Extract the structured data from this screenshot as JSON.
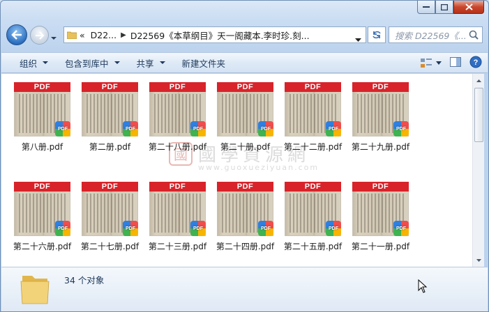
{
  "window": {
    "address_path": [
      "D22...",
      "D22569《本草纲目》天一阁藏本.李时珍.刻..."
    ],
    "address_prefix": "«",
    "search_placeholder": "搜索 D22569《..."
  },
  "toolbar": {
    "organize": "组织",
    "include_in_library": "包含到库中",
    "share": "共享",
    "new_folder": "新建文件夹"
  },
  "files": [
    {
      "name": "第八册.pdf"
    },
    {
      "name": "第二册.pdf"
    },
    {
      "name": "第二十八册.pdf"
    },
    {
      "name": "第二十册.pdf"
    },
    {
      "name": "第二十二册.pdf"
    },
    {
      "name": "第二十九册.pdf"
    },
    {
      "name": "第二十六册.pdf"
    },
    {
      "name": "第二十七册.pdf"
    },
    {
      "name": "第二十三册.pdf"
    },
    {
      "name": "第二十四册.pdf"
    },
    {
      "name": "第二十五册.pdf"
    },
    {
      "name": "第二十一册.pdf"
    }
  ],
  "pdf_band_label": "PDF",
  "pdf_badge_label": "PDF",
  "watermark": {
    "seal": "國",
    "title": "國學資源網",
    "url": "www.guoxueziyuan.com"
  },
  "status": {
    "item_count": "34 个对象"
  },
  "colors": {
    "pdf_red": "#d8232a",
    "accent": "#1e395b"
  }
}
